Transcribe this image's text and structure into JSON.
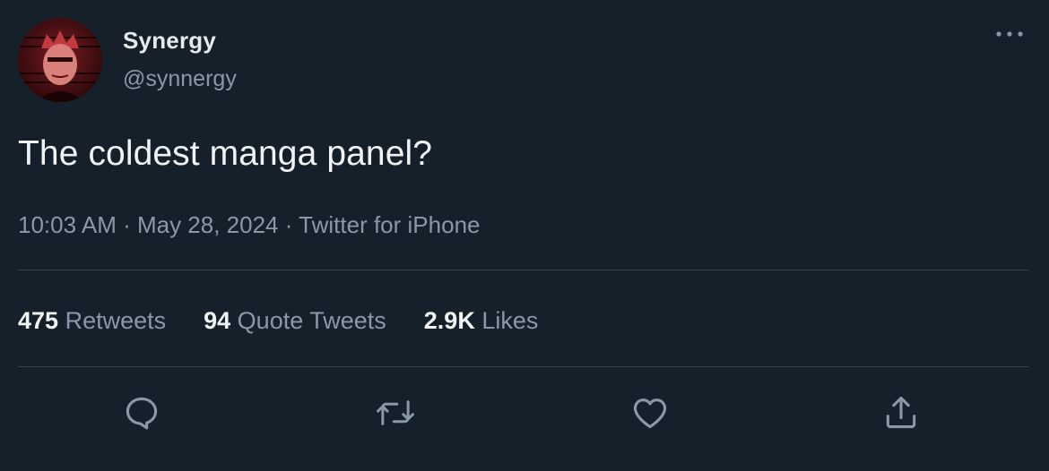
{
  "author": {
    "display_name": "Synergy",
    "handle": "@synnergy"
  },
  "tweet": {
    "text": "The coldest manga panel?"
  },
  "meta": {
    "time": "10:03 AM",
    "separator": " · ",
    "date": "May 28, 2024",
    "source": "Twitter for iPhone"
  },
  "stats": {
    "retweets_count": "475",
    "retweets_label": " Retweets",
    "quotes_count": "94",
    "quotes_label": " Quote Tweets",
    "likes_count": "2.9K",
    "likes_label": " Likes"
  },
  "actions": [
    {
      "icon": "reply-icon"
    },
    {
      "icon": "retweet-icon"
    },
    {
      "icon": "like-heart-icon"
    },
    {
      "icon": "share-icon"
    }
  ],
  "more_icon": "more-options-icon",
  "colors": {
    "background": "#15202b",
    "primary_text": "#e7e9ea",
    "secondary_text": "#8b98a5",
    "divider": "#38444d"
  }
}
